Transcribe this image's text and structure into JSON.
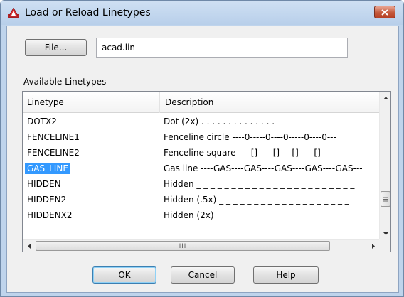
{
  "window": {
    "title": "Load or Reload Linetypes"
  },
  "file": {
    "button_label": "File...",
    "path_value": "acad.lin"
  },
  "list": {
    "section_label": "Available Linetypes",
    "columns": [
      "Linetype",
      "Description"
    ],
    "rows": [
      {
        "name": "DOTX2",
        "description": "Dot (2x) . . . . . . . . . . . . . ."
      },
      {
        "name": "FENCELINE1",
        "description": "Fenceline circle ----0-----0----0-----0----0---"
      },
      {
        "name": "FENCELINE2",
        "description": "Fenceline square ----[]-----[]----[]-----[]----"
      },
      {
        "name": "GAS_LINE",
        "description": "Gas line ----GAS----GAS----GAS----GAS----GAS---",
        "selected": true
      },
      {
        "name": "HIDDEN",
        "description": "Hidden _ _ _ _ _ _ _ _ _ _ _ _ _ _ _ _ _ _ _ _ _ _ _"
      },
      {
        "name": "HIDDEN2",
        "description": "Hidden (.5x) _ _ _ _ _ _ _ _ _ _ _ _ _ _ _ _ _ _ _"
      },
      {
        "name": "HIDDENX2",
        "description": "Hidden (2x) ____ ____ ____ ____ ____ ____ ____"
      }
    ],
    "scroll_glyph": "III"
  },
  "buttons": {
    "ok": "OK",
    "cancel": "Cancel",
    "help": "Help"
  },
  "colors": {
    "selection": "#3399ff",
    "close_button": "#c45a3c"
  }
}
